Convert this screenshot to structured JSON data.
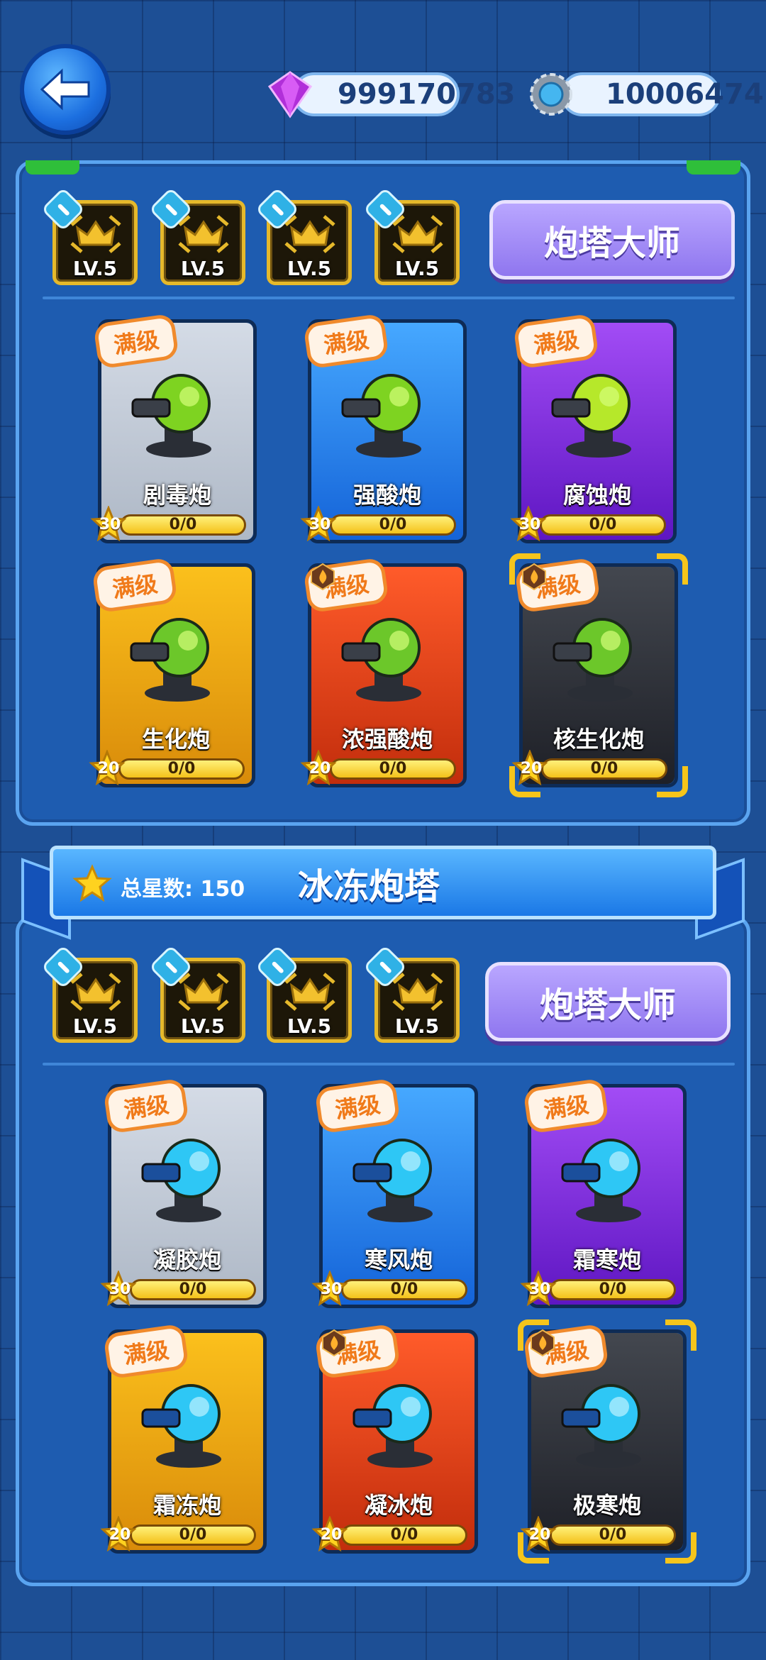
{
  "header": {
    "gems": "999170783",
    "gears": "10006474"
  },
  "sections": [
    {
      "title": "",
      "master_button": "炮塔大师",
      "badges": [
        {
          "lv": "LV.5"
        },
        {
          "lv": "LV.5"
        },
        {
          "lv": "LV.5"
        },
        {
          "lv": "LV.5"
        }
      ],
      "cards": [
        {
          "name": "剧毒炮",
          "progress": "0/0",
          "stars": "30",
          "tag": "满级",
          "rarity": "white",
          "accent": "#7ed321"
        },
        {
          "name": "强酸炮",
          "progress": "0/0",
          "stars": "30",
          "tag": "满级",
          "rarity": "blue",
          "accent": "#7ed321"
        },
        {
          "name": "腐蚀炮",
          "progress": "0/0",
          "stars": "30",
          "tag": "满级",
          "rarity": "purple",
          "accent": "#b6e82a"
        },
        {
          "name": "生化炮",
          "progress": "0/0",
          "stars": "20",
          "tag": "满级",
          "rarity": "gold",
          "accent": "#6cc72a"
        },
        {
          "name": "浓强酸炮",
          "progress": "0/0",
          "stars": "20",
          "tag": "满级",
          "rarity": "red",
          "accent": "#6cc72a"
        },
        {
          "name": "核生化炮",
          "progress": "0/0",
          "stars": "20",
          "tag": "满级",
          "rarity": "dark",
          "accent": "#6cc72a"
        }
      ]
    },
    {
      "title": "冰冻炮塔",
      "total_stars_label": "总星数:",
      "total_stars": "150",
      "master_button": "炮塔大师",
      "badges": [
        {
          "lv": "LV.5"
        },
        {
          "lv": "LV.5"
        },
        {
          "lv": "LV.5"
        },
        {
          "lv": "LV.5"
        }
      ],
      "cards": [
        {
          "name": "凝胶炮",
          "progress": "0/0",
          "stars": "30",
          "tag": "满级",
          "rarity": "white",
          "accent": "#2ec7f5"
        },
        {
          "name": "寒风炮",
          "progress": "0/0",
          "stars": "30",
          "tag": "满级",
          "rarity": "blue",
          "accent": "#2ec7f5"
        },
        {
          "name": "霜寒炮",
          "progress": "0/0",
          "stars": "30",
          "tag": "满级",
          "rarity": "purple",
          "accent": "#2ec7f5"
        },
        {
          "name": "霜冻炮",
          "progress": "0/0",
          "stars": "20",
          "tag": "满级",
          "rarity": "gold",
          "accent": "#2ec7f5"
        },
        {
          "name": "凝冰炮",
          "progress": "0/0",
          "stars": "20",
          "tag": "满级",
          "rarity": "red",
          "accent": "#2ec7f5"
        },
        {
          "name": "极寒炮",
          "progress": "0/0",
          "stars": "20",
          "tag": "满级",
          "rarity": "dark",
          "accent": "#2ec7f5"
        }
      ]
    }
  ]
}
